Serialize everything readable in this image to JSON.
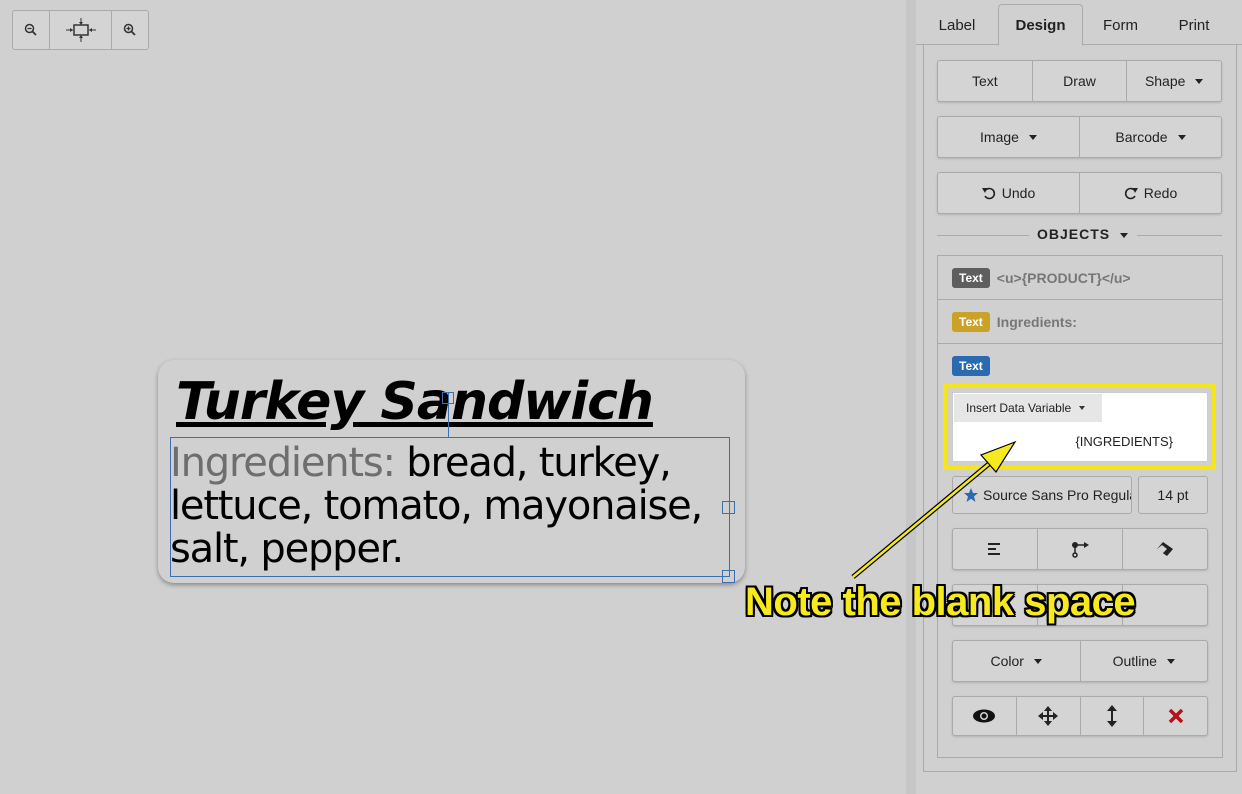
{
  "canvas": {
    "label": {
      "title": "Turkey Sandwich",
      "ingredients_label": "Ingredients:",
      "ingredients_text": " bread, turkey, lettuce, tomato, mayonaise, salt, pepper."
    }
  },
  "panel": {
    "tabs": [
      "Label",
      "Design",
      "Form",
      "Print"
    ],
    "active_tab": "Design",
    "toolbar_row1": [
      "Text",
      "Draw",
      "Shape"
    ],
    "toolbar_row2": [
      "Image",
      "Barcode"
    ],
    "undo": "Undo",
    "redo": "Redo",
    "objects_header": "OBJECTS",
    "objects": [
      {
        "badge": "Text",
        "badge_color": "#5e5e5e",
        "text": "<u>{PRODUCT}</u>"
      },
      {
        "badge": "Text",
        "badge_color": "#c9a227",
        "text": "Ingredients:"
      },
      {
        "badge": "Text",
        "badge_color": "#2a6ab0",
        "text": ""
      }
    ],
    "insert_variable": "Insert Data Variable",
    "editor_text": "{INGREDIENTS}",
    "font_name": "Source Sans Pro Regular",
    "font_size": "14 pt",
    "color_btn": "Color",
    "outline_btn": "Outline"
  },
  "annotation": {
    "callout": "Note the blank space",
    "highlight_color": "#f4e619"
  }
}
